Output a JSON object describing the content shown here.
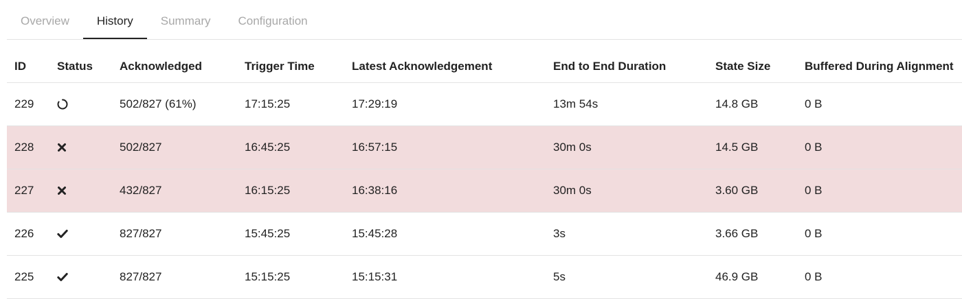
{
  "tabs": [
    {
      "label": "Overview",
      "active": false
    },
    {
      "label": "History",
      "active": true
    },
    {
      "label": "Summary",
      "active": false
    },
    {
      "label": "Configuration",
      "active": false
    }
  ],
  "columns": [
    "ID",
    "Status",
    "Acknowledged",
    "Trigger Time",
    "Latest Acknowledgement",
    "End to End Duration",
    "State Size",
    "Buffered During Alignment"
  ],
  "rows": [
    {
      "id": "229",
      "status_icon": "in-progress-icon",
      "acknowledged": "502/827 (61%)",
      "trigger_time": "17:15:25",
      "latest_ack": "17:29:19",
      "duration": "13m 54s",
      "state_size": "14.8 GB",
      "buffered": "0 B"
    },
    {
      "id": "228",
      "status_icon": "failed-icon",
      "acknowledged": "502/827",
      "trigger_time": "16:45:25",
      "latest_ack": "16:57:15",
      "duration": "30m 0s",
      "state_size": "14.5 GB",
      "buffered": "0 B"
    },
    {
      "id": "227",
      "status_icon": "failed-icon",
      "acknowledged": "432/827",
      "trigger_time": "16:15:25",
      "latest_ack": "16:38:16",
      "duration": "30m 0s",
      "state_size": "3.60 GB",
      "buffered": "0 B"
    },
    {
      "id": "226",
      "status_icon": "completed-icon",
      "acknowledged": "827/827",
      "trigger_time": "15:45:25",
      "latest_ack": "15:45:28",
      "duration": "3s",
      "state_size": "3.66 GB",
      "buffered": "0 B"
    },
    {
      "id": "225",
      "status_icon": "completed-icon",
      "acknowledged": "827/827",
      "trigger_time": "15:15:25",
      "latest_ack": "15:15:31",
      "duration": "5s",
      "state_size": "46.9 GB",
      "buffered": "0 B"
    }
  ],
  "colors": {
    "failed_row_bg": "#f2dcdd",
    "active_tab": "#222222",
    "inactive_tab": "#a8a8a8"
  }
}
